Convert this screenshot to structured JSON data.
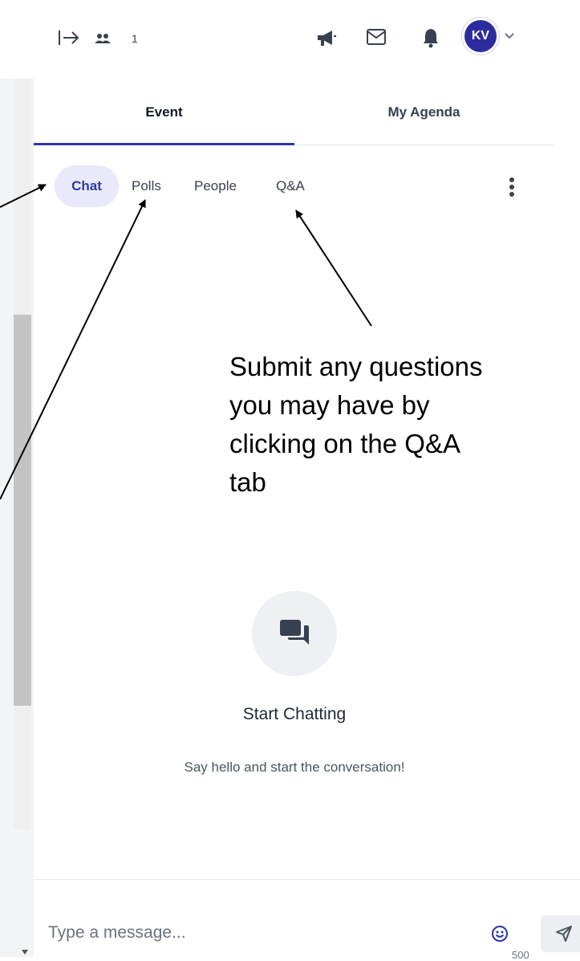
{
  "topbar": {
    "attendee_count": "1",
    "avatar_initials": "KV"
  },
  "main_tabs": [
    {
      "label": "Event",
      "active": true
    },
    {
      "label": "My Agenda",
      "active": false
    }
  ],
  "sub_tabs": [
    {
      "label": "Chat",
      "active": true
    },
    {
      "label": "Polls",
      "active": false
    },
    {
      "label": "People",
      "active": false
    },
    {
      "label": "Q&A",
      "active": false
    }
  ],
  "annotation": {
    "text": "Submit any questions\nyou may have by\nclicking on the Q&A\ntab"
  },
  "empty_state": {
    "title": "Start Chatting",
    "subtitle": "Say hello and start the conversation!"
  },
  "composer": {
    "placeholder": "Type a message...",
    "char_counter": "500"
  },
  "colors": {
    "accent": "#2b36a8",
    "active_tab_bg": "#e9e9fb",
    "avatar_bg": "#2c2c9e"
  },
  "icons": [
    "collapse-panel-icon",
    "attendees-icon",
    "megaphone-icon",
    "mail-icon",
    "bell-icon",
    "chevron-down-icon",
    "more-vertical-icon",
    "chat-bubble-icon",
    "emoji-icon",
    "send-icon"
  ]
}
